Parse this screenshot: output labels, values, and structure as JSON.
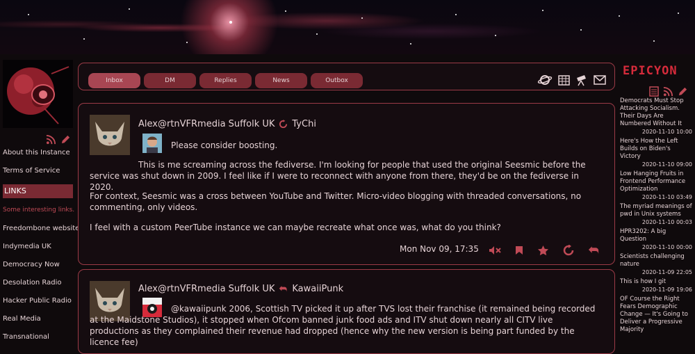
{
  "left": {
    "links": {
      "about": "About this Instance",
      "terms": "Terms of Service",
      "heading": "LINKS",
      "items": [
        "Some interesting links.",
        "Freedombone website",
        "Indymedia UK",
        "Democracy Now",
        "Desolation Radio",
        "Hacker Public Radio",
        "Real Media",
        "Transnational"
      ]
    }
  },
  "tabs": [
    "Inbox",
    "DM",
    "Replies",
    "News",
    "Outbox"
  ],
  "posts": [
    {
      "author": "Alex@rtnVFRmedia Suffolk UK",
      "boosted_by": "TyChi",
      "intro": "Please consider boosting.",
      "paragraphs": [
        "This is me screaming across the fediverse. I'm looking for people that used the original Seesmic before the service was shut down in 2009. I feel like if I were to reconnect with anyone from there, they'd be on the fediverse in 2020.",
        "For context, Seesmic was a cross between YouTube and Twitter. Micro-video blogging with threaded conversations, no commenting, only videos.",
        "I feel with a custom PeerTube instance we can maybe recreate what once was, what do you think?"
      ],
      "date": "Mon Nov 09, 17:35"
    },
    {
      "author": "Alex@rtnVFRmedia Suffolk UK",
      "reply_to": "KawaiiPunk",
      "paragraph": "@kawaiipunk 2006, Scottish TV picked it up after TVS lost their franchise (it remained being recorded at the Maidstone Studios), it stopped when Ofcom banned junk food ads and ITV shut down nearly all CITV live productions as they complained their revenue had dropped (hence why the new version is being part funded by the licence fee)"
    }
  ],
  "right": {
    "logo": "EPICYON",
    "news": [
      {
        "title": "Democrats Must Stop Attacking Socialism. Their Days Are Numbered Without It",
        "date": "2020-11-10 10:00"
      },
      {
        "title": "Here's How the Left Builds on Biden's Victory",
        "date": "2020-11-10 09:00"
      },
      {
        "title": "Low Hanging Fruits in Frontend Performance Optimization",
        "date": "2020-11-10 03:49"
      },
      {
        "title": "The myriad meanings of pwd in Unix systems",
        "date": "2020-11-10 00:03"
      },
      {
        "title": "HPR3202: A big Question",
        "date": "2020-11-10 00:00"
      },
      {
        "title": "Scientists challenging nature",
        "date": "2020-11-09 22:05"
      },
      {
        "title": "This is how I git",
        "date": "2020-11-09 19:06"
      },
      {
        "title": "OF Course the Right Fears Demographic Change — It's Going to Deliver a Progressive Majority",
        "date": ""
      }
    ]
  },
  "colors": {
    "accent": "#d62b3b",
    "border": "#9c3b47",
    "tab": "#7a2a33",
    "tab_active": "#a84653",
    "bg": "#0f0a0c"
  }
}
